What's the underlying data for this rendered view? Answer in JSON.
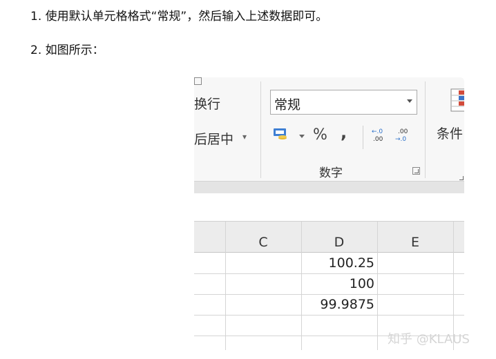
{
  "instructions": {
    "step1": "1. 使用默认单元格格式“常规”，然后输入上述数据即可。",
    "step2": "2. 如图所示："
  },
  "ribbon": {
    "wrap_text": "换行",
    "merge_center": "后居中",
    "number_format_value": "常规",
    "percent": "%",
    "comma": ",",
    "increase_decimal": {
      "top": "←.0",
      "bottom": ".00"
    },
    "decrease_decimal": {
      "top": ".00",
      "bottom": "→.0"
    },
    "number_group_label": "数字",
    "conditional_format_label": "条件"
  },
  "sheet": {
    "columns": [
      "C",
      "D",
      "E"
    ],
    "rows": [
      {
        "C": "",
        "D": "100.25",
        "E": ""
      },
      {
        "C": "",
        "D": "100",
        "E": ""
      },
      {
        "C": "",
        "D": "99.9875",
        "E": ""
      },
      {
        "C": "",
        "D": "",
        "E": ""
      }
    ]
  },
  "watermark": "知乎 @KLAUS",
  "colors": {
    "ribbon_bg": "#f7f7f7",
    "header_bg": "#ececec",
    "gridline": "#d4d4d4"
  }
}
